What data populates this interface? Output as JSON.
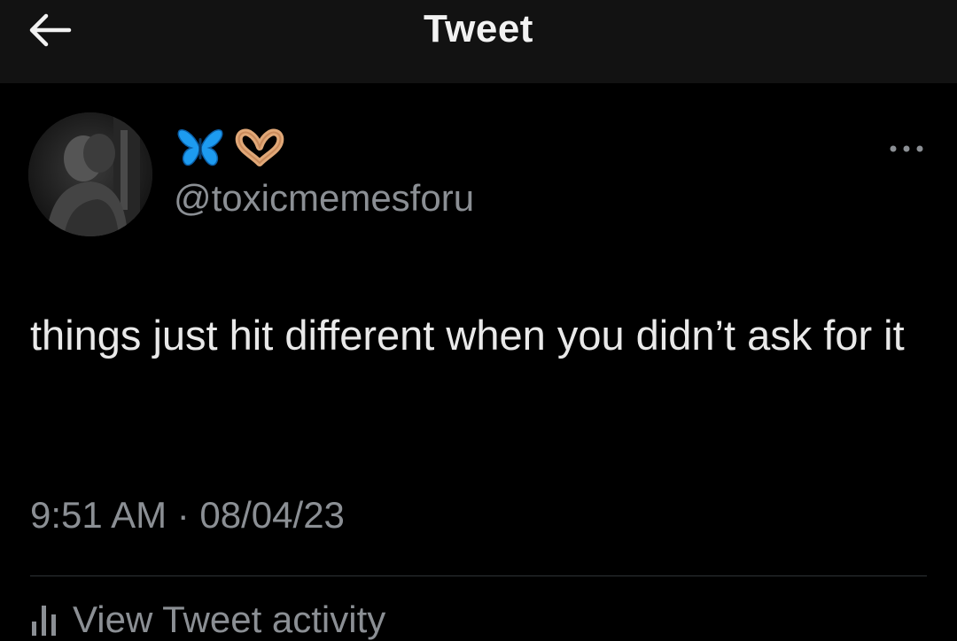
{
  "header": {
    "title": "Tweet",
    "back_icon": "arrow-left-icon"
  },
  "tweet": {
    "author": {
      "display_name_icons": [
        "butterfly-emoji-icon",
        "heart-hands-emoji-icon"
      ],
      "handle": "@toxicmemesforu"
    },
    "text": "things just hit different when you didn’t ask for it",
    "timestamp": "9:51 AM · 08/04/23",
    "activity_label": "View Tweet activity",
    "more_icon": "more-dots-icon"
  },
  "colors": {
    "background": "#000000",
    "topbar": "#121212",
    "primary_text": "#e9e9e9",
    "secondary_text": "#8b8f94",
    "divider": "#2f3336",
    "butterfly": "#1d9bf0"
  }
}
